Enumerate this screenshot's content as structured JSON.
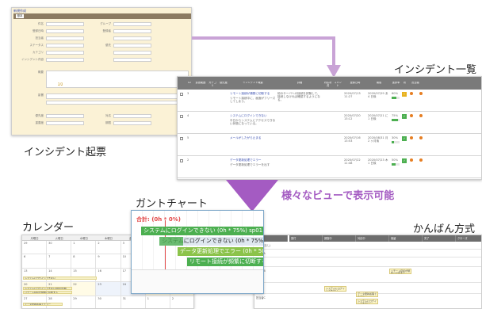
{
  "captions": {
    "incident_form": "インシデント起票",
    "incident_list": "インシデント一覧",
    "gantt": "ガントチャート",
    "calendar": "カレンダー",
    "kanban": "かんばん方式",
    "views_banner": "様々なビューで表示可能"
  },
  "colors": {
    "accent_purple": "#a45bc2",
    "arrow_purple": "#c9a3d6",
    "form_header": "#8c7b62",
    "table_header": "#7a7a7a",
    "form_bg": "#fbf2d6"
  },
  "form": {
    "title": "新規作成",
    "tab": "基本",
    "due_value": "2/2",
    "labels": [
      "件名",
      "登録日時",
      "担当者",
      "ステータス",
      "カテゴリ",
      "インシデント内容",
      "概要",
      "影響",
      "",
      "優先度",
      "重要度"
    ],
    "right_labels": [
      "グループ",
      "登録者",
      "",
      "優先",
      "",
      "",
      "",
      "",
      "",
      "対応",
      "期限"
    ]
  },
  "table": {
    "headers": [
      "",
      "ID",
      "影響範囲",
      "カテゴリ",
      "優先度",
      "インシデント概要",
      "詳細",
      "対応状況",
      "コメント",
      "登録日時",
      "期限",
      "進捗率",
      "状",
      "担当者"
    ],
    "rows": [
      {
        "id": "3",
        "title": "リモート接続が頻繁に切断する",
        "desc": "リモート接続中に、画面がフリーズしてしまう。",
        "detail": "他のサーバへの接続を試験して、接続しなければ確認するようになる。",
        "created": "2020/07/13 11:27",
        "due": "2020/07/29 あ 4 日後",
        "progress": "60%",
        "prog_val": 0.6,
        "status_color": "#e8b21f",
        "status": "!"
      },
      {
        "id": "4",
        "title": "システムにログインできない",
        "desc": "平日からシステムにアクセスできない状態になっている。",
        "detail": "",
        "created": "2020/07/20 13:12",
        "due": "2020/07/21 に 1 日後",
        "progress": "75%",
        "prog_val": 0.75,
        "status_color": "#4caf50",
        "status": "✓"
      },
      {
        "id": "5",
        "title": "メールがしたがら止まる",
        "desc": "",
        "detail": "",
        "created": "2020/07/16 13:53",
        "due": "2020/08/31 月 2 ヶ月後",
        "progress": "30%",
        "prog_val": 0.3,
        "status_color": "#4caf50",
        "status": "✓"
      },
      {
        "id": "2",
        "title": "データ更新処理でエラー",
        "desc": "データ更新処理でエラーを出す",
        "detail": "",
        "created": "2020/07/22 11:48",
        "due": "2020/07/23 木 1 日後",
        "progress": "50%",
        "prog_val": 0.5,
        "status_color": "#4caf50",
        "status": "✓"
      }
    ]
  },
  "gantt": {
    "summary": "合計: (0h * 0%)",
    "bars": [
      {
        "text": "システムにログインできない (0h * 75%) sp01 : 進捗"
      },
      {
        "text": "システムにログインできない (0h * 75%) 001 : 実施中"
      },
      {
        "text": "データ更新処理でエラー (0h * 50%) 001"
      },
      {
        "text": "リモート接続が頻繁に切断する (0h * 60%"
      }
    ]
  },
  "calendar": {
    "weekdays": [
      "月曜日",
      "火曜日",
      "水曜日",
      "木曜日",
      "金曜日",
      "土曜日",
      "日曜日"
    ],
    "days": [
      "29",
      "30",
      "1",
      "2",
      "3",
      "4",
      "5",
      "6",
      "7",
      "8",
      "9",
      "10",
      "11",
      "12",
      "13",
      "14",
      "15",
      "16",
      "17",
      "18",
      "19",
      "20",
      "21",
      "22",
      "23",
      "24",
      "25",
      "26",
      "27",
      "28",
      "29",
      "30",
      "31",
      "1",
      "2"
    ],
    "events": [
      "システムにログインできない",
      "システムにログインできない(障害影響)",
      "リモート接続が頻繁に切断する",
      "データ更新処理でエラー"
    ]
  },
  "kanban": {
    "columns": [
      "未着手",
      "受付",
      "調査中",
      "対応中",
      "保留",
      "完了",
      "クローズ"
    ],
    "rows": [
      "担当者(なし)",
      "担当者A",
      "",
      "管理者B",
      "",
      "担当者C"
    ],
    "cards": [
      "リモート接続が頻繁に切断する",
      "システムにログインできない",
      "データ更新処理でエラー",
      "システムにログインできない"
    ]
  }
}
